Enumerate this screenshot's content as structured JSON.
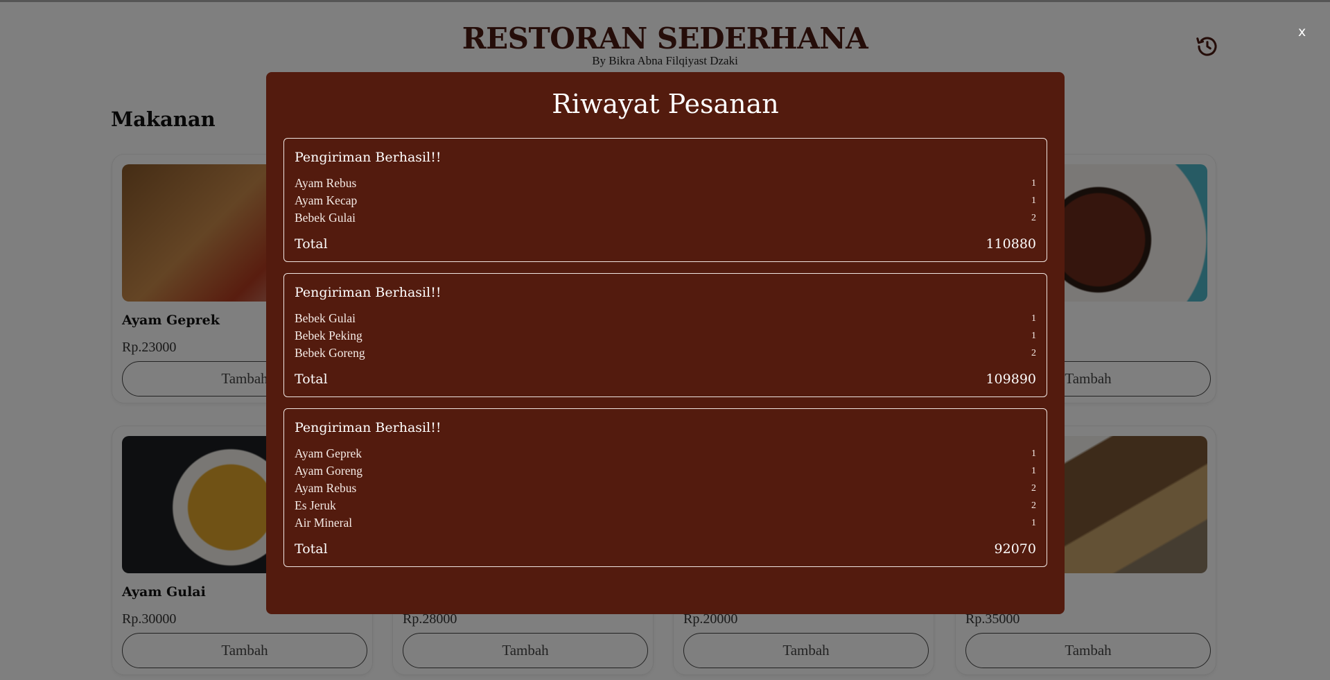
{
  "header": {
    "title": "RESTORAN SEDERHANA",
    "subtitle": "By Bikra Abna Filqiyast Dzaki",
    "history_icon": "history-icon"
  },
  "menu": {
    "section_title": "Makanan",
    "cards": [
      {
        "name": "Ayam Geprek",
        "price": "Rp.23000",
        "button": "Tambah"
      },
      {
        "name": "",
        "price": "",
        "button": "Tambah"
      },
      {
        "name": "Ayam Gulai",
        "price": "Rp.30000",
        "button": "Tambah"
      },
      {
        "name": "",
        "price": "Rp.28000",
        "button": "Tambah"
      },
      {
        "name": "",
        "price": "Rp.20000",
        "button": "Tambah"
      },
      {
        "name": "",
        "price": "Rp.35000",
        "button": "Tambah"
      }
    ]
  },
  "modal": {
    "close_label": "x",
    "title": "Riwayat Pesanan",
    "total_label": "Total",
    "orders": [
      {
        "status": "Pengiriman Berhasil!!",
        "items": [
          {
            "name": "Ayam Rebus",
            "qty": "1"
          },
          {
            "name": "Ayam Kecap",
            "qty": "1"
          },
          {
            "name": "Bebek Gulai",
            "qty": "2"
          }
        ],
        "total": "110880"
      },
      {
        "status": "Pengiriman Berhasil!!",
        "items": [
          {
            "name": "Bebek Gulai",
            "qty": "1"
          },
          {
            "name": "Bebek Peking",
            "qty": "1"
          },
          {
            "name": "Bebek Goreng",
            "qty": "2"
          }
        ],
        "total": "109890"
      },
      {
        "status": "Pengiriman Berhasil!!",
        "items": [
          {
            "name": "Ayam Geprek",
            "qty": "1"
          },
          {
            "name": "Ayam Goreng",
            "qty": "1"
          },
          {
            "name": "Ayam Rebus",
            "qty": "2"
          },
          {
            "name": "Es Jeruk",
            "qty": "2"
          },
          {
            "name": "Air Mineral",
            "qty": "1"
          }
        ],
        "total": "92070"
      }
    ]
  },
  "colors": {
    "modal_bg": "#531b0e",
    "brand": "#4a1a12",
    "overlay": "rgba(0,0,0,0.5)"
  }
}
